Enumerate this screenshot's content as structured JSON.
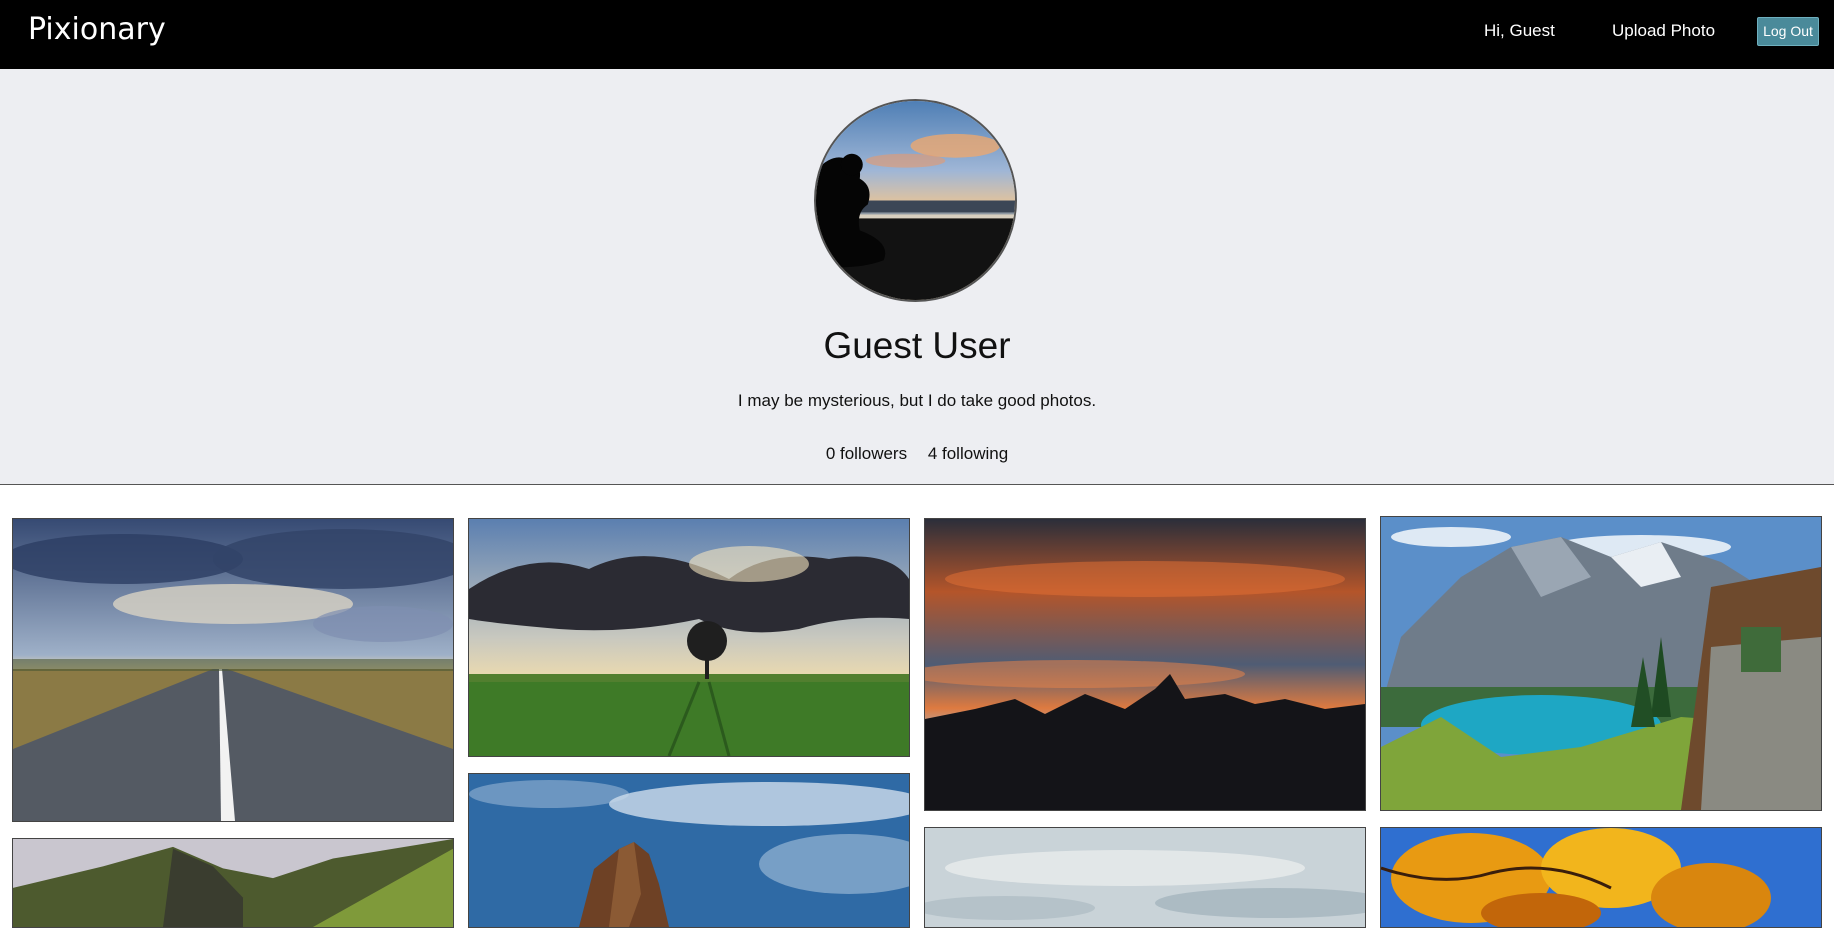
{
  "nav": {
    "brand": "Pixionary",
    "greeting": "Hi, Guest",
    "upload_label": "Upload Photo",
    "logout_label": "Log Out"
  },
  "profile": {
    "name": "Guest User",
    "bio": "I may be mysterious, but I do take good photos.",
    "followers": "0 followers",
    "following": "4 following"
  },
  "colors": {
    "navbar_bg": "#000000",
    "profile_bg": "#edeef2",
    "logout_button": "#4a8a9a"
  }
}
